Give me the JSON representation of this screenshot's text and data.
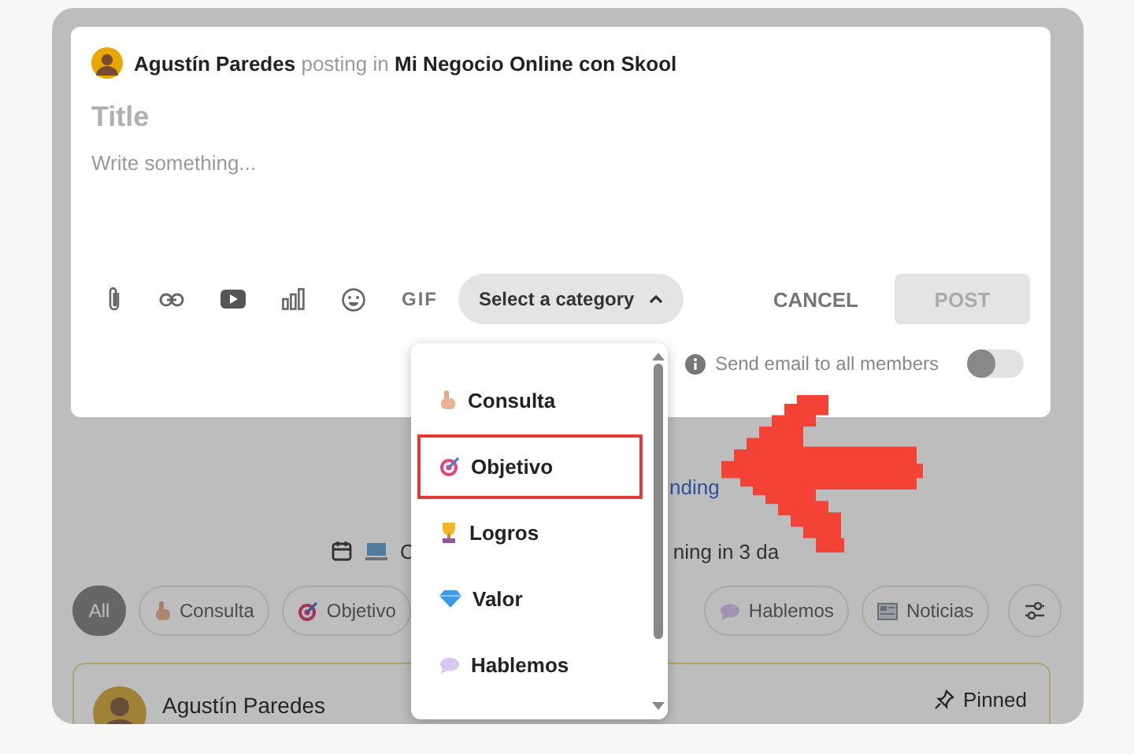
{
  "composer": {
    "author": "Agustín Paredes",
    "posting_in": "posting in",
    "community": "Mi Negocio Online con Skool",
    "title_placeholder": "Title",
    "body_placeholder": "Write something...",
    "gif_label": "GIF",
    "category_button": "Select a category",
    "cancel": "CANCEL",
    "post": "POST",
    "post_disabled": true,
    "email_label": "Send email to all members",
    "email_on": false
  },
  "category_menu": {
    "items": [
      {
        "label": "Consulta",
        "highlighted": false
      },
      {
        "label": "Objetivo",
        "highlighted": true
      },
      {
        "label": "Logros",
        "highlighted": false
      },
      {
        "label": "Valor",
        "highlighted": false
      },
      {
        "label": "Hablemos",
        "highlighted": false
      }
    ]
  },
  "background": {
    "link_fragment": "nding",
    "event_prefix": "C",
    "event_suffix": "ning in 3 da",
    "chips": [
      {
        "label": "All",
        "selected": true
      },
      {
        "label": "Consulta",
        "selected": false
      },
      {
        "label": "Objetivo",
        "selected": false
      },
      {
        "label": "Hablemos",
        "selected": false
      },
      {
        "label": "Noticias",
        "selected": false
      }
    ],
    "post": {
      "author": "Agustín Paredes",
      "pinned": "Pinned"
    }
  }
}
